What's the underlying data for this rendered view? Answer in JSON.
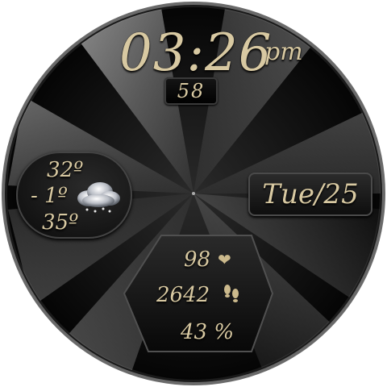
{
  "clock": {
    "time": "03:26",
    "ampm": "pm",
    "seconds": "58"
  },
  "date": {
    "text": "Tue/25"
  },
  "weather": {
    "high": "32º",
    "current": "- 1º",
    "low": "35º",
    "icon": "cloud-snow-icon"
  },
  "stats": {
    "heart_rate": "98",
    "heart_icon": "heart-icon",
    "steps": "2642",
    "steps_icon": "footsteps-icon",
    "battery": "43 %"
  },
  "colors": {
    "text_gold": "#d8c9a2",
    "face_dark": "#0a0a0a",
    "bezel": "#555555"
  }
}
